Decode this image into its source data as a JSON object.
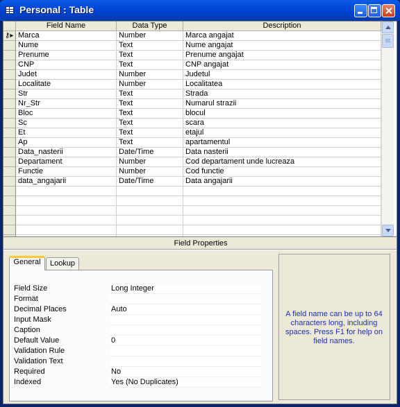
{
  "window": {
    "title": "Personal : Table"
  },
  "grid": {
    "headers": {
      "field_name": "Field Name",
      "data_type": "Data Type",
      "description": "Description"
    },
    "rows": [
      {
        "name": "Marca",
        "type": "Number",
        "desc": "Marca angajat",
        "primary_key": true
      },
      {
        "name": "Nume",
        "type": "Text",
        "desc": "Nume angajat"
      },
      {
        "name": "Prenume",
        "type": "Text",
        "desc": "Prenume angajat"
      },
      {
        "name": "CNP",
        "type": "Text",
        "desc": "CNP angajat"
      },
      {
        "name": "Judet",
        "type": "Number",
        "desc": "Judetul"
      },
      {
        "name": "Localitate",
        "type": "Number",
        "desc": "Localitatea"
      },
      {
        "name": "Str",
        "type": "Text",
        "desc": "Strada"
      },
      {
        "name": "Nr_Str",
        "type": "Text",
        "desc": "Numarul strazii"
      },
      {
        "name": "Bloc",
        "type": "Text",
        "desc": "blocul"
      },
      {
        "name": "Sc",
        "type": "Text",
        "desc": "scara"
      },
      {
        "name": "Et",
        "type": "Text",
        "desc": "etajul"
      },
      {
        "name": "Ap",
        "type": "Text",
        "desc": "apartamentul"
      },
      {
        "name": "Data_nasterii",
        "type": "Date/Time",
        "desc": "Data nasterii"
      },
      {
        "name": "Departament",
        "type": "Number",
        "desc": "Cod departament unde lucreaza"
      },
      {
        "name": "Functie",
        "type": "Number",
        "desc": "Cod functie"
      },
      {
        "name": "data_angajarii",
        "type": "Date/Time",
        "desc": "Data angajarii"
      },
      {
        "name": "",
        "type": "",
        "desc": ""
      },
      {
        "name": "",
        "type": "",
        "desc": ""
      },
      {
        "name": "",
        "type": "",
        "desc": ""
      },
      {
        "name": "",
        "type": "",
        "desc": ""
      },
      {
        "name": "",
        "type": "",
        "desc": ""
      },
      {
        "name": "",
        "type": "",
        "desc": ""
      }
    ]
  },
  "field_properties": {
    "title": "Field Properties",
    "tabs": {
      "general": "General",
      "lookup": "Lookup"
    },
    "properties": [
      {
        "label": "Field Size",
        "value": "Long Integer"
      },
      {
        "label": "Format",
        "value": ""
      },
      {
        "label": "Decimal Places",
        "value": "Auto"
      },
      {
        "label": "Input Mask",
        "value": ""
      },
      {
        "label": "Caption",
        "value": ""
      },
      {
        "label": "Default Value",
        "value": "0"
      },
      {
        "label": "Validation Rule",
        "value": ""
      },
      {
        "label": "Validation Text",
        "value": ""
      },
      {
        "label": "Required",
        "value": "No"
      },
      {
        "label": "Indexed",
        "value": "Yes (No Duplicates)"
      }
    ],
    "help_text": "A field name can be up to 64 characters long, including spaces.  Press F1 for help on field names."
  },
  "icons": {
    "title_icon": "table-icon",
    "key_marker": "primary-key-icon"
  },
  "colors": {
    "titlebar": "#0046d5",
    "help_text": "#1b2eb0",
    "panel": "#ece9d8"
  }
}
